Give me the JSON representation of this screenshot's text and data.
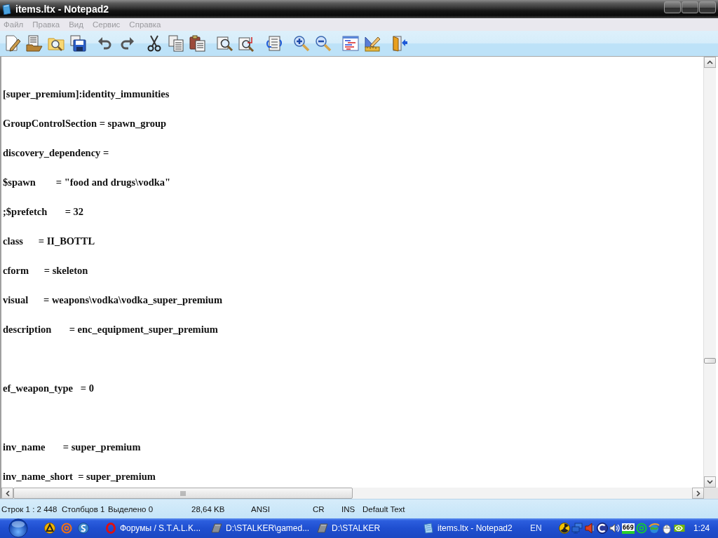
{
  "window": {
    "title": "items.ltx - Notepad2"
  },
  "menu": [
    {
      "label": "Файл"
    },
    {
      "label": "Правка"
    },
    {
      "label": "Вид"
    },
    {
      "label": "Сервис"
    },
    {
      "label": "Справка"
    }
  ],
  "editor": {
    "lines": [
      {
        "kind": "code",
        "text": "[super_premium]:identity_immunities"
      },
      {
        "kind": "code",
        "text": "GroupControlSection = spawn_group"
      },
      {
        "kind": "code",
        "text": "discovery_dependency ="
      },
      {
        "kind": "code",
        "text": "$spawn        = \"food and drugs\\vodka\""
      },
      {
        "kind": "code",
        "text": ";$prefetch       = 32"
      },
      {
        "kind": "code",
        "text": "class      = II_BOTTL"
      },
      {
        "kind": "code",
        "text": "cform      = skeleton"
      },
      {
        "kind": "code",
        "text": "visual      = weapons\\vodka\\vodka_super_premium"
      },
      {
        "kind": "code",
        "text": "description       = enc_equipment_super_premium"
      },
      {
        "kind": "blank"
      },
      {
        "kind": "code",
        "text": "ef_weapon_type   = 0"
      },
      {
        "kind": "blank"
      },
      {
        "kind": "code",
        "text": "inv_name       = super_premium"
      },
      {
        "kind": "code",
        "text": "inv_name_short  = super_premium"
      }
    ]
  },
  "status_bar": {
    "items": [
      "Строк 1 : 2 448",
      "Столбцов 1",
      "Выделено 0",
      "28,64 KB",
      "ANSI",
      "CR",
      "INS",
      "Default Text"
    ]
  },
  "taskbar": {
    "tasks": [
      {
        "kind": "browser",
        "label": "Форумы / S.T.A.L.K..."
      },
      {
        "kind": "folder",
        "label": "D:\\STALKER\\gamed..."
      },
      {
        "kind": "folder",
        "label": "D:\\STALKER"
      },
      {
        "kind": "notepad",
        "label": "items.ltx - Notepad2"
      }
    ],
    "language": "EN",
    "tray_meter": "669",
    "clock": "1:24"
  }
}
